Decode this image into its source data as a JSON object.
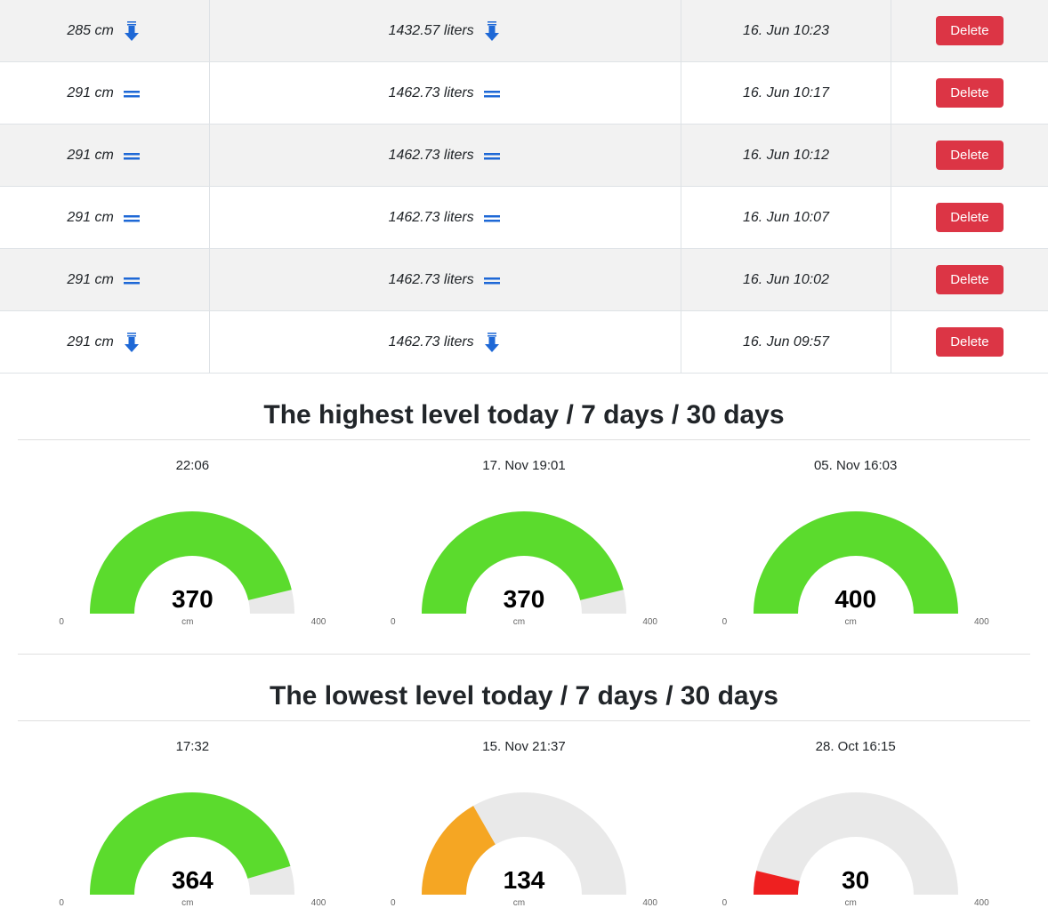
{
  "table": {
    "rows": [
      {
        "level": "285 cm",
        "volume": "1432.57 liters",
        "timestamp": "16. Jun 10:23",
        "trend": "down"
      },
      {
        "level": "291 cm",
        "volume": "1462.73 liters",
        "timestamp": "16. Jun 10:17",
        "trend": "stable"
      },
      {
        "level": "291 cm",
        "volume": "1462.73 liters",
        "timestamp": "16. Jun 10:12",
        "trend": "stable"
      },
      {
        "level": "291 cm",
        "volume": "1462.73 liters",
        "timestamp": "16. Jun 10:07",
        "trend": "stable"
      },
      {
        "level": "291 cm",
        "volume": "1462.73 liters",
        "timestamp": "16. Jun 10:02",
        "trend": "stable"
      },
      {
        "level": "291 cm",
        "volume": "1462.73 liters",
        "timestamp": "16. Jun 09:57",
        "trend": "down"
      }
    ],
    "delete_label": "Delete"
  },
  "sections": {
    "highest": {
      "title": "The highest level today / 7 days / 30 days",
      "gauges": [
        {
          "time": "22:06",
          "value": "370",
          "min": "0",
          "max": "400",
          "unit": "cm",
          "fill_pct": 92.5,
          "color": "#5bdb2d"
        },
        {
          "time": "17. Nov 19:01",
          "value": "370",
          "min": "0",
          "max": "400",
          "unit": "cm",
          "fill_pct": 92.5,
          "color": "#5bdb2d"
        },
        {
          "time": "05. Nov 16:03",
          "value": "400",
          "min": "0",
          "max": "400",
          "unit": "cm",
          "fill_pct": 100,
          "color": "#5bdb2d"
        }
      ]
    },
    "lowest": {
      "title": "The lowest level today / 7 days / 30 days",
      "gauges": [
        {
          "time": "17:32",
          "value": "364",
          "min": "0",
          "max": "400",
          "unit": "cm",
          "fill_pct": 91,
          "color": "#5bdb2d"
        },
        {
          "time": "15. Nov 21:37",
          "value": "134",
          "min": "0",
          "max": "400",
          "unit": "cm",
          "fill_pct": 33.5,
          "color": "#f5a623"
        },
        {
          "time": "28. Oct 16:15",
          "value": "30",
          "min": "0",
          "max": "400",
          "unit": "cm",
          "fill_pct": 7.5,
          "color": "#ee2020"
        }
      ]
    }
  },
  "chart_data": [
    {
      "type": "gauge",
      "title": "Highest today",
      "label": "22:06",
      "value": 370,
      "min": 0,
      "max": 400,
      "unit": "cm"
    },
    {
      "type": "gauge",
      "title": "Highest 7 days",
      "label": "17. Nov 19:01",
      "value": 370,
      "min": 0,
      "max": 400,
      "unit": "cm"
    },
    {
      "type": "gauge",
      "title": "Highest 30 days",
      "label": "05. Nov 16:03",
      "value": 400,
      "min": 0,
      "max": 400,
      "unit": "cm"
    },
    {
      "type": "gauge",
      "title": "Lowest today",
      "label": "17:32",
      "value": 364,
      "min": 0,
      "max": 400,
      "unit": "cm"
    },
    {
      "type": "gauge",
      "title": "Lowest 7 days",
      "label": "15. Nov 21:37",
      "value": 134,
      "min": 0,
      "max": 400,
      "unit": "cm"
    },
    {
      "type": "gauge",
      "title": "Lowest 30 days",
      "label": "28. Oct 16:15",
      "value": 30,
      "min": 0,
      "max": 400,
      "unit": "cm"
    }
  ]
}
